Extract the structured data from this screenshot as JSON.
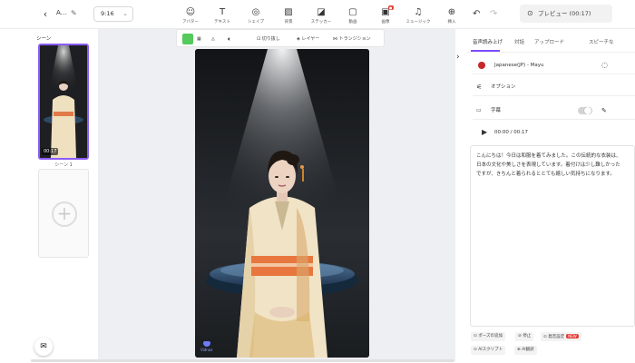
{
  "project": {
    "title": "A...",
    "ratio": "9:16"
  },
  "toolbar": [
    {
      "label": "アバター",
      "icon": "avatar-icon",
      "glyph": "☺"
    },
    {
      "label": "テキスト",
      "icon": "text-icon",
      "glyph": "T"
    },
    {
      "label": "シェイプ",
      "icon": "shapes-icon",
      "glyph": "◎"
    },
    {
      "label": "背景",
      "icon": "background-icon",
      "glyph": "▨"
    },
    {
      "label": "ステッカー",
      "icon": "sticker-icon",
      "glyph": "◪"
    },
    {
      "label": "動画",
      "icon": "video-icon",
      "glyph": "▢"
    },
    {
      "label": "画像",
      "icon": "image-icon",
      "glyph": "▣"
    },
    {
      "label": "ミュージック",
      "icon": "music-icon",
      "glyph": "♫"
    },
    {
      "label": "挿入",
      "icon": "insert-icon",
      "glyph": "⊕"
    }
  ],
  "preview": {
    "label": "プレビュー (00:17)"
  },
  "scenes": {
    "title": "シーン",
    "items": [
      {
        "label": "シーン 1",
        "duration": "00:17"
      }
    ]
  },
  "canvas_toolbar": {
    "crop": "切り抜し",
    "layer": "レイヤー",
    "transition": "トランジション"
  },
  "watermark": "Vidnoz",
  "right_panel": {
    "tabs": [
      "音声読み上げ",
      "対話",
      "アップロード",
      "スピーチな"
    ],
    "voice": "Japanese(JP) - Mayu",
    "options": "オプション",
    "subtitles": "字幕",
    "time": "00:00 / 00:17",
    "script": "こんにちは！今日は和服を着てみました。この伝統的な衣装は、日本の文化や美しさを表現しています。着付けは少し難しかったですが、きちんと着られるととても嬉しい気持ちになります。",
    "chips": [
      "ポーズの追加",
      "停止",
      "発音設定",
      "AIスクリプト",
      "AI翻訳"
    ],
    "new_badge": "NEW"
  },
  "colors": {
    "accent": "#7c4dff",
    "scene_border": "#8b5cf6",
    "green": "#54c95c"
  }
}
